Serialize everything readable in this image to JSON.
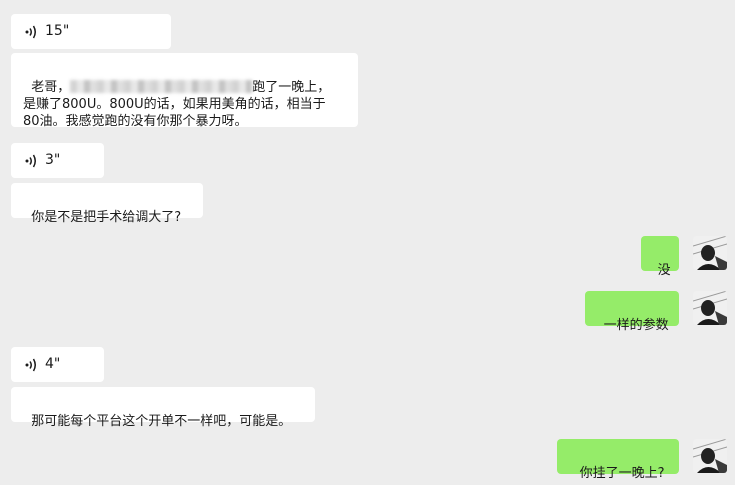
{
  "messages": {
    "voice1": {
      "duration": "15\""
    },
    "text1": {
      "before_redaction": "老哥，",
      "after_redaction": "跑了一晚上，",
      "rest": "是赚了800U。800U的话，如果用美角的话，相当于\n80油。我感觉跑的没有你那个暴力呀。"
    },
    "voice2": {
      "duration": "3\""
    },
    "text2": "你是不是把手术给调大了?",
    "out1": "没",
    "out2": "一样的参数",
    "voice3": {
      "duration": "4\""
    },
    "text3": "那可能每个平台这个开单不一样吧，可能是。",
    "out3": "你挂了一晚上?"
  },
  "icons": {
    "voice": "voice-wave-icon",
    "avatar": "avatar"
  },
  "colors": {
    "background": "#ededed",
    "incoming": "#ffffff",
    "outgoing": "#95ec69"
  }
}
